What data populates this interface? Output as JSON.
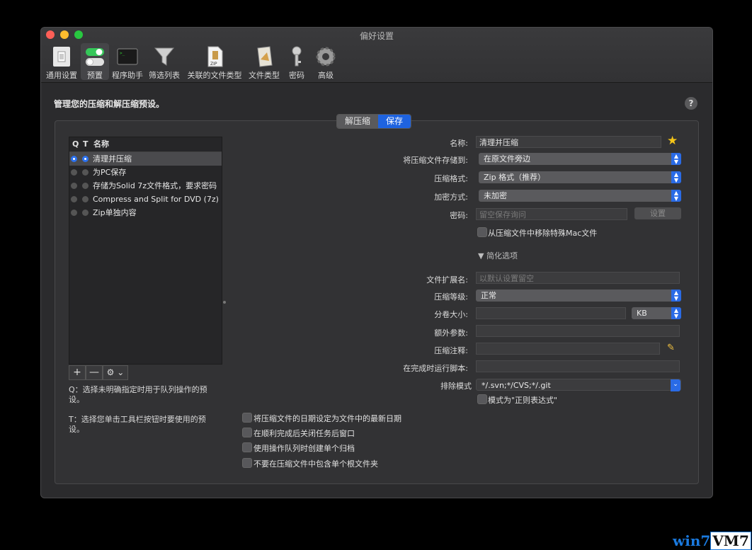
{
  "window": {
    "title": "偏好设置"
  },
  "toolbar": {
    "items": [
      {
        "label": "通用设置",
        "icon": "switch-icon"
      },
      {
        "label": "预置",
        "icon": "toggles-icon",
        "selected": true
      },
      {
        "label": "程序助手",
        "icon": "terminal-icon"
      },
      {
        "label": "筛选列表",
        "icon": "funnel-icon"
      },
      {
        "label": "关联的文件类型",
        "icon": "zip-file-icon"
      },
      {
        "label": "文件类型",
        "icon": "document-icon"
      },
      {
        "label": "密码",
        "icon": "key-icon"
      },
      {
        "label": "高级",
        "icon": "gear-icon"
      }
    ]
  },
  "main": {
    "heading": "管理您的压缩和解压缩预设。",
    "help": "?",
    "tabs": [
      {
        "label": "解压缩",
        "active": false
      },
      {
        "label": "保存",
        "active": true
      }
    ]
  },
  "presets": {
    "headers": {
      "q": "Q",
      "t": "T",
      "name": "名称"
    },
    "rows": [
      {
        "name": "清理并压缩",
        "q": true,
        "t": true,
        "selected": true
      },
      {
        "name": "为PC保存",
        "q": false,
        "t": false
      },
      {
        "name": "存储为Solid 7z文件格式，要求密码",
        "q": false,
        "t": false
      },
      {
        "name": "Compress and Split for DVD (7z)",
        "q": false,
        "t": false
      },
      {
        "name": "Zip单独内容",
        "q": false,
        "t": false
      }
    ],
    "add": "+",
    "remove": "—",
    "action": "⚙ ⌄",
    "note_q": "Q：选择未明确指定时用于队列操作的预设。",
    "note_t": "T：选择您单击工具栏按钮时要使用的预设。"
  },
  "form": {
    "name_label": "名称:",
    "name_value": "清理并压缩",
    "dest_label": "将压缩文件存储到:",
    "dest_value": "在原文件旁边",
    "format_label": "压缩格式:",
    "format_value": "Zip 格式（推荐）",
    "encrypt_label": "加密方式:",
    "encrypt_value": "未加密",
    "password_label": "密码:",
    "password_placeholder": "留空保存询问",
    "password_button": "设置",
    "remove_mac_label": "从压缩文件中移除特殊Mac文件",
    "simplified_label": "简化选项",
    "ext_label": "文件扩展名:",
    "ext_placeholder": "以默认设置留空",
    "level_label": "压缩等级:",
    "level_value": "正常",
    "split_label": "分卷大小:",
    "split_value": "",
    "split_unit": "KB",
    "extra_label": "额外参数:",
    "extra_value": "",
    "comment_label": "压缩注释:",
    "comment_value": "",
    "script_label": "在完成时运行脚本:",
    "script_value": "",
    "exclude_label": "排除模式",
    "exclude_value": "*/.svn;*/CVS;*/.git",
    "regex_label": "模式为\"正则表达式\"",
    "opt1": "将压缩文件的日期设定为文件中的最新日期",
    "opt2": "在顺利完成后关闭任务后窗口",
    "opt3": "使用操作队列时创建单个归档",
    "opt4": "不要在压缩文件中包含单个根文件夹"
  },
  "watermark": {
    "part1": "win7",
    "part2": "VM7"
  }
}
